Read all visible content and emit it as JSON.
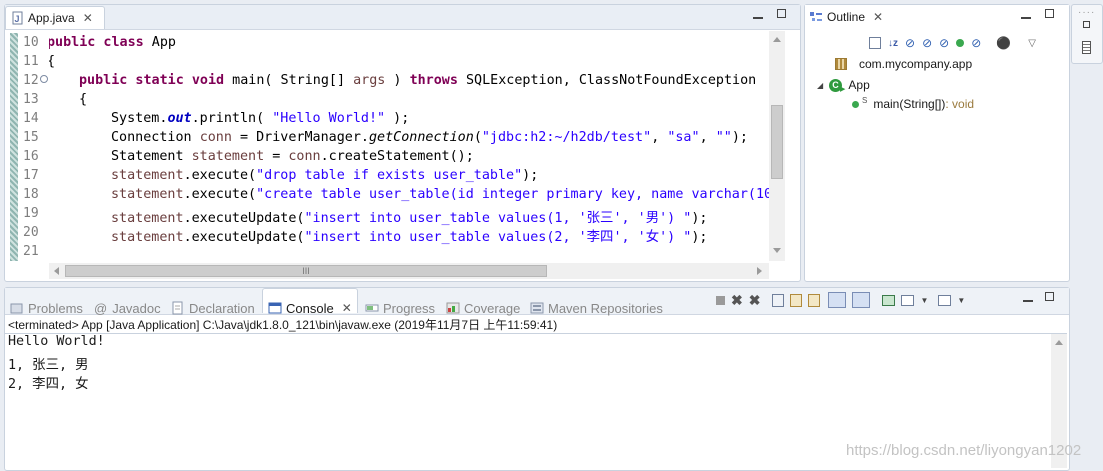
{
  "editor": {
    "tab_label": "App.java",
    "lines": [
      {
        "num": "10"
      },
      {
        "num": "11"
      },
      {
        "num": "12"
      },
      {
        "num": "13"
      },
      {
        "num": "14"
      },
      {
        "num": "15"
      },
      {
        "num": "16"
      },
      {
        "num": "17"
      },
      {
        "num": "18"
      },
      {
        "num": "19"
      },
      {
        "num": "20"
      },
      {
        "num": "21"
      }
    ],
    "code": {
      "l10_kw": "public class",
      "l10_rest": " App",
      "l11": "{",
      "l12_kw1": "public static void",
      "l12_a": " main( String[] ",
      "l12_var": "args",
      "l12_b": " ) ",
      "l12_kw2": "throws",
      "l12_c": " SQLException, ClassNotFoundException",
      "l13": "{",
      "l14_a": "System.",
      "l14_out": "out",
      "l14_b": ".println( ",
      "l14_str": "\"Hello World!\"",
      "l14_c": " );",
      "l15_a": "Connection ",
      "l15_var": "conn",
      "l15_b": " = DriverManager.",
      "l15_m": "getConnection",
      "l15_c": "(",
      "l15_s1": "\"jdbc:h2:~/h2db/test\"",
      "l15_d": ", ",
      "l15_s2": "\"sa\"",
      "l15_e": ", ",
      "l15_s3": "\"\"",
      "l15_f": ");",
      "l16_a": "Statement ",
      "l16_var": "statement",
      "l16_b": " = ",
      "l16_v2": "conn",
      "l16_c": ".createStatement();",
      "l17_var": "statement",
      "l17_a": ".execute(",
      "l17_str": "\"drop table if exists user_table\"",
      "l17_b": ");",
      "l18_var": "statement",
      "l18_a": ".execute(",
      "l18_str": "\"create table user_table(id integer primary key, name varchar(10",
      "l19_var": "statement",
      "l19_a": ".executeUpdate(",
      "l19_str": "\"insert into user_table values(1, '张三', '男') \"",
      "l19_b": ");",
      "l20_var": "statement",
      "l20_a": ".executeUpdate(",
      "l20_str": "\"insert into user_table values(2, '李四', '女') \"",
      "l20_b": ");"
    },
    "hscroll_grip": "III"
  },
  "outline": {
    "tab_label": "Outline",
    "package": "com.mycompany.app",
    "class_name": "App",
    "method_name": "main(String[])",
    "method_type": " : void",
    "static_marker": "S"
  },
  "bottom_tabs": [
    {
      "label": "Problems"
    },
    {
      "label": "Javadoc"
    },
    {
      "label": "Declaration"
    },
    {
      "label": "Console"
    },
    {
      "label": "Progress"
    },
    {
      "label": "Coverage"
    },
    {
      "label": "Maven Repositories"
    }
  ],
  "console": {
    "status": "<terminated> App [Java Application] C:\\Java\\jdk1.8.0_121\\bin\\javaw.exe (2019年11月7日 上午11:59:41)",
    "output": [
      "Hello World!",
      "1, 张三, 男",
      "2, 李四, 女"
    ]
  },
  "watermark": "https://blog.csdn.net/liyongyan1202",
  "colors": {
    "keyword": "#7f0055",
    "string": "#2a00ff",
    "field": "#0000c0",
    "background": "#e9edf3"
  }
}
